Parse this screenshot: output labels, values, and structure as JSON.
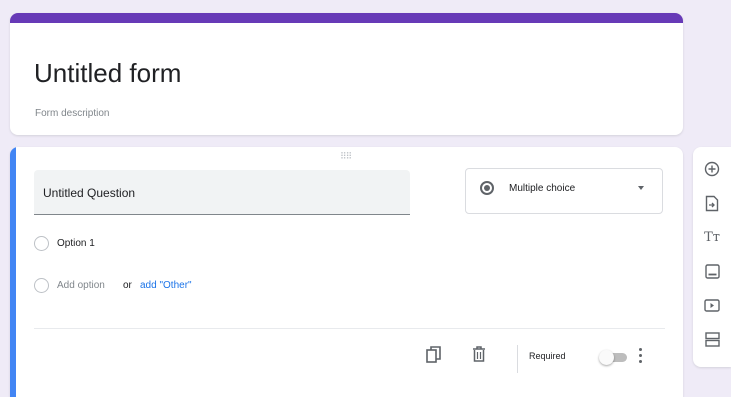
{
  "form": {
    "title": "Untitled form",
    "description_placeholder": "Form description"
  },
  "question": {
    "title": "Untitled Question",
    "type": "Multiple choice",
    "options": [
      "Option 1"
    ],
    "add_option": "Add option",
    "or": "or",
    "add_other": "add \"Other\"",
    "required_label": "Required",
    "required": false
  },
  "icons": {
    "toolbar": [
      "add-question-icon",
      "import-questions-icon",
      "add-title-icon",
      "add-image-icon",
      "add-video-icon",
      "add-section-icon"
    ],
    "footer": [
      "duplicate-icon",
      "delete-icon",
      "more-vert-icon"
    ]
  },
  "colors": {
    "accent": "#673ab7",
    "active_card": "#4285f4",
    "link": "#1a73e8",
    "background": "#efebf7"
  }
}
